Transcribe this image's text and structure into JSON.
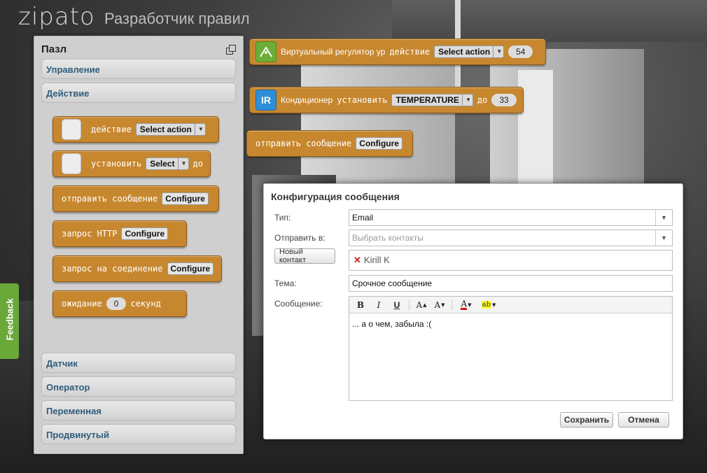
{
  "header": {
    "logo": "zipato",
    "title": "Разработчик правил"
  },
  "feedback": "Feedback",
  "panel": {
    "title": "Пазл",
    "categories_top": [
      "Управление",
      "Действие"
    ],
    "categories_bottom": [
      "Датчик",
      "Оператор",
      "Переменная",
      "Продвинутый"
    ],
    "palette": {
      "b1": {
        "label": "действие",
        "select": "Select action"
      },
      "b2": {
        "label": "установить",
        "select": "Select",
        "suffix": "до"
      },
      "b3": {
        "label": "отправить сообщение",
        "button": "Configure"
      },
      "b4": {
        "label": "запрос HTTP",
        "button": "Configure"
      },
      "b5": {
        "label": "запрос на соединение",
        "button": "Configure"
      },
      "b6": {
        "label": "ожидание",
        "value": "0",
        "suffix": "секунд"
      }
    }
  },
  "workspace": {
    "w1": {
      "device": "Виртуальный регулятор ур",
      "label": "действие",
      "select": "Select action",
      "value": "54"
    },
    "w2": {
      "icon": "IR",
      "device": "Кондиционер",
      "label": "установить",
      "select": "TEMPERATURE",
      "suffix": "до",
      "value": "33"
    },
    "w3": {
      "label": "отправить сообщение",
      "button": "Configure"
    }
  },
  "dialog": {
    "title": "Конфигурация сообщения",
    "type_label": "Тип:",
    "type_value": "Email",
    "to_label": "Отправить в:",
    "to_placeholder": "Выбрать контакты",
    "new_contact": "Новый контакт",
    "contact": "Kirill K",
    "subject_label": "Тема:",
    "subject_value": "Срочное сообщение",
    "message_label": "Сообщение:",
    "message_value": "... а о чем, забыла :(",
    "save": "Сохранить",
    "cancel": "Отмена"
  }
}
